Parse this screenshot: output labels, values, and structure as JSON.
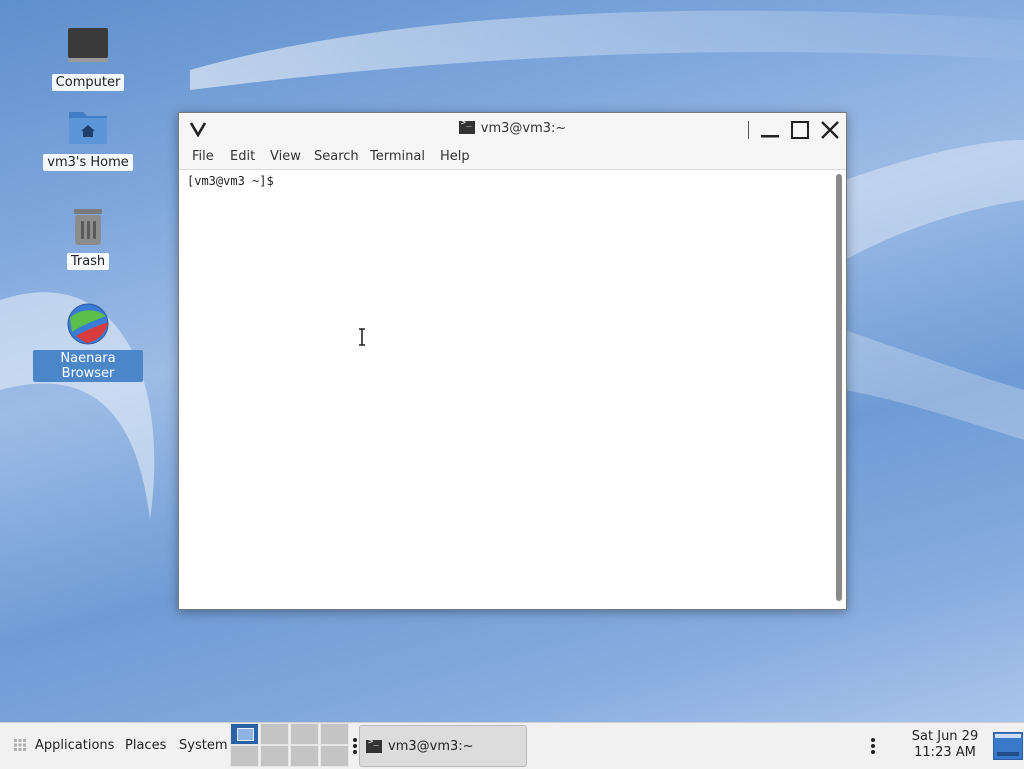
{
  "desktop": {
    "icons": [
      {
        "label": "Computer",
        "icon": "computer-icon"
      },
      {
        "label": "vm3's Home",
        "icon": "home-folder-icon"
      },
      {
        "label": "Trash",
        "icon": "trash-icon"
      },
      {
        "label": "Naenara Browser",
        "icon": "browser-globe-icon"
      }
    ]
  },
  "window": {
    "title": "vm3@vm3:~",
    "app_icon": "terminal-icon",
    "menu": [
      "File",
      "Edit",
      "View",
      "Search",
      "Terminal",
      "Help"
    ],
    "prompt": "[vm3@vm3 ~]$"
  },
  "taskbar": {
    "applications": "Applications",
    "places": "Places",
    "system": "System",
    "task_label": "vm3@vm3:~",
    "date": "Sat Jun 29",
    "time": "11:23 AM"
  },
  "colors": {
    "accent": "#2a62a8",
    "selection": "#4a86c8"
  }
}
